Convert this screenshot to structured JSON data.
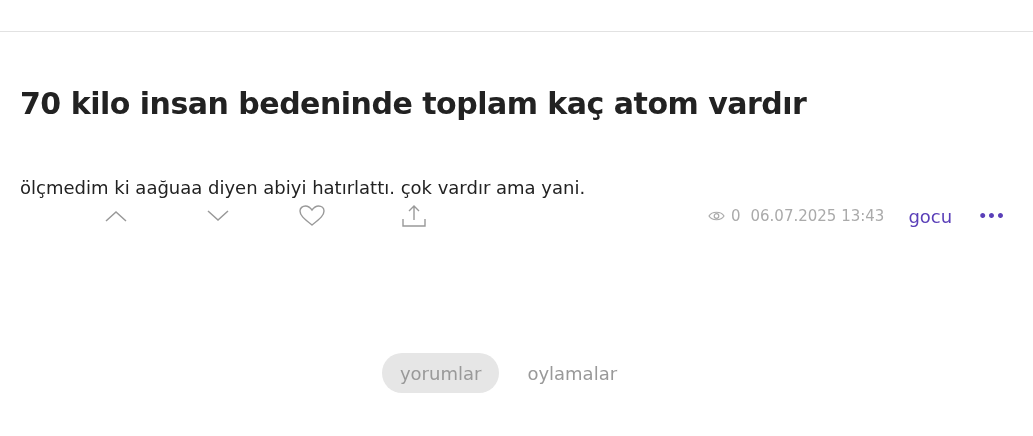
{
  "entry": {
    "title": "70 kilo insan bedeninde toplam kaç atom vardır",
    "body": "ölçmedim ki aağuaa diyen abiyi hatırlattı. çok vardır ama yani.",
    "views": "0",
    "date": "06.07.2025 13:43",
    "author": "gocu",
    "more": "•••"
  },
  "tabs": [
    {
      "label": "yorumlar",
      "selected": true
    },
    {
      "label": "oylamalar",
      "selected": false
    }
  ]
}
